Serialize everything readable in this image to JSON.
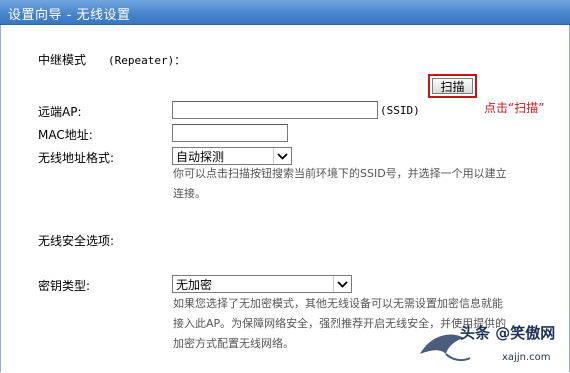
{
  "window": {
    "title": "设置向导 - 无线设置"
  },
  "mode": {
    "label": "中继模式",
    "value": "(Repeater)："
  },
  "remote_ap": {
    "label": "远端AP:",
    "value": "",
    "suffix": "(SSID)"
  },
  "scan": {
    "button_label": "扫描",
    "annotation": "点击“扫描”"
  },
  "mac": {
    "label": "MAC地址:",
    "value": ""
  },
  "addr_format": {
    "label": "无线地址格式:",
    "selected": "自动探测"
  },
  "scan_hint": {
    "line1": "你可以点击扫描按钮搜索当前环境下的SSID号，并选择一个用以建立",
    "line2": "连接。"
  },
  "security_section": {
    "label": "无线安全选项:"
  },
  "key_type": {
    "label": "密钥类型:",
    "selected": "无加密"
  },
  "security_hint": {
    "line1": "如果您选择了无加密模式，其他无线设备可以无需设置加密信息就能",
    "line2": "接入此AP。为保障网络安全，强烈推荐开启无线安全，并使用提供的",
    "line3": "加密方式配置无线网络。"
  },
  "watermark": {
    "text": "头条 @笑傲网",
    "site": "xajjn.com"
  },
  "colors": {
    "title_bar": "#4a86cc",
    "annotation_red": "#d0161b",
    "hint_gray": "#555555"
  }
}
